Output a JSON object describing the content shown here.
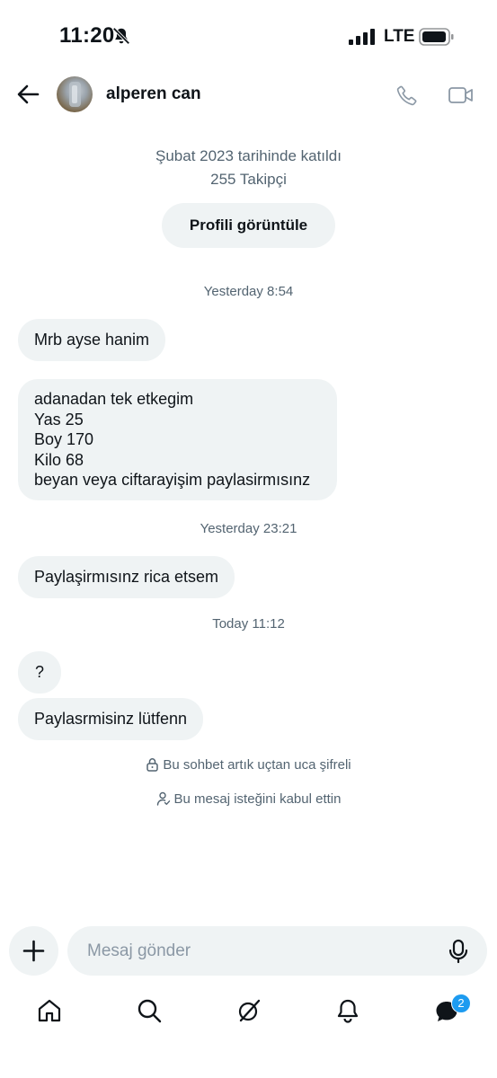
{
  "status_bar": {
    "time": "11:20",
    "network": "LTE"
  },
  "header": {
    "name": "alperen can"
  },
  "profile": {
    "joined": "Şubat 2023 tarihinde katıldı",
    "followers": "255 Takipçi",
    "view_profile_label": "Profili görüntüle"
  },
  "timestamps": [
    "Yesterday 8:54",
    "Yesterday 23:21",
    "Today 11:12"
  ],
  "messages": [
    {
      "text": "Mrb ayse hanim"
    },
    {
      "lines": [
        "adanadan tek etkegim",
        "Yas 25",
        "Boy 170",
        "Kilo 68",
        "beyan veya ciftarayişim paylasirmısınz"
      ]
    },
    {
      "text": "Paylaşirmısınz rica etsem"
    },
    {
      "text": "?"
    },
    {
      "text": "Paylasrmisinz lütfenn"
    }
  ],
  "notices": {
    "encrypted": "Bu sohbet artık uçtan uca şifreli",
    "accepted": "Bu mesaj isteğini kabul ettin"
  },
  "composer": {
    "placeholder": "Mesaj gönder"
  },
  "nav": {
    "messages_badge": "2"
  },
  "icons": [
    "back-arrow-icon",
    "phone-icon",
    "video-camera-icon",
    "lock-icon",
    "user-check-icon",
    "plus-icon",
    "microphone-icon",
    "home-icon",
    "search-icon",
    "grok-icon",
    "bell-icon",
    "messages-icon"
  ]
}
